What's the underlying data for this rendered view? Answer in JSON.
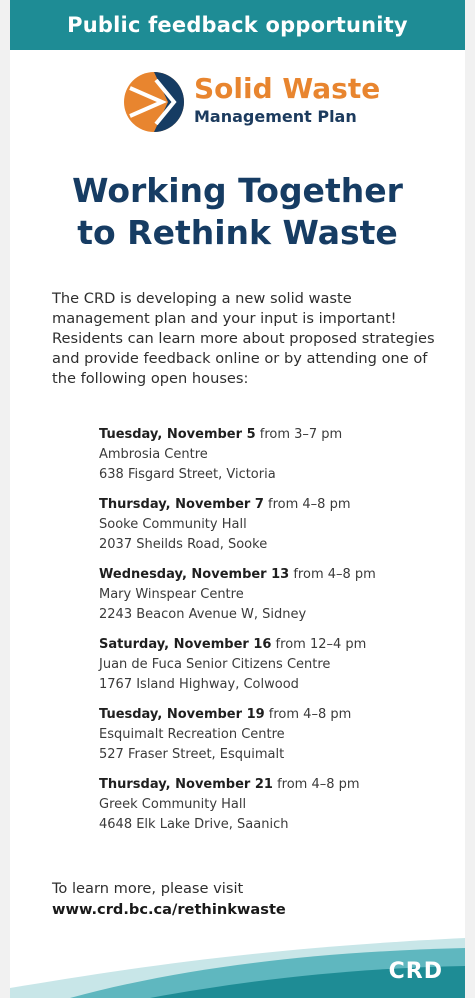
{
  "banner": {
    "text": "Public feedback opportunity"
  },
  "logo": {
    "title": "Solid Waste",
    "subtitle": "Management Plan",
    "colors": {
      "orange": "#e8852f",
      "navy": "#163c63"
    }
  },
  "headline": {
    "line1": "Working Together",
    "line2": "to Rethink Waste"
  },
  "intro": "The CRD is developing a new solid waste management plan and your input is important! Residents can learn more about proposed strategies and provide feedback online or by attending one of the following open houses:",
  "events": [
    {
      "day": "Tuesday, November 5",
      "time": " from 3–7 pm",
      "venue": "Ambrosia Centre",
      "address": "638 Fisgard Street, Victoria"
    },
    {
      "day": "Thursday, November 7",
      "time": " from 4–8 pm",
      "venue": "Sooke Community Hall",
      "address": "2037 Sheilds Road, Sooke"
    },
    {
      "day": "Wednesday, November 13",
      "time": " from 4–8 pm",
      "venue": "Mary Winspear Centre",
      "address": "2243 Beacon Avenue W, Sidney"
    },
    {
      "day": "Saturday, November 16",
      "time": " from 12–4 pm",
      "venue": "Juan de Fuca Senior Citizens Centre",
      "address": "1767 Island Highway, Colwood"
    },
    {
      "day": "Tuesday, November 19",
      "time": " from 4–8 pm",
      "venue": "Esquimalt Recreation Centre",
      "address": "527 Fraser Street, Esquimalt"
    },
    {
      "day": "Thursday, November 21",
      "time": " from 4–8 pm",
      "venue": "Greek Community Hall",
      "address": "4648 Elk Lake Drive, Saanich"
    }
  ],
  "footer": {
    "lead": "To learn more, please visit",
    "url": "www.crd.bc.ca/rethinkwaste"
  },
  "brand": {
    "name": "CRD",
    "teal": "#1e8c95"
  }
}
